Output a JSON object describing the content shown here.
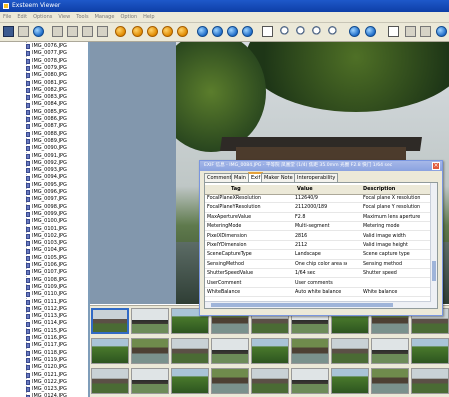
{
  "window": {
    "title": "Exsteem Viewer"
  },
  "menu": [
    "File",
    "Edit",
    "Options",
    "View",
    "Tools",
    "Manage",
    "Option",
    "Help"
  ],
  "toolbar_icons": [
    "save-icon",
    "open-icon",
    "refresh-icon",
    "cut-icon",
    "copy-icon",
    "paste-icon",
    "delete-icon",
    "circle-icon",
    "prev-icon",
    "next-icon",
    "first-icon",
    "last-icon",
    "back-icon",
    "forward-icon",
    "up-icon",
    "down-icon",
    "blank-icon",
    "zoom-in-icon",
    "zoom-out-icon",
    "zoom-fit-icon",
    "zoom-actual-icon",
    "rotate-left-icon",
    "rotate-right-icon",
    "doc-icon",
    "info-icon",
    "slideshow-icon",
    "exit-icon"
  ],
  "files": [
    "IMG_0076.JPG",
    "IMG_0077.JPG",
    "IMG_0078.JPG",
    "IMG_0079.JPG",
    "IMG_0080.JPG",
    "IMG_0081.JPG",
    "IMG_0082.JPG",
    "IMG_0083.JPG",
    "IMG_0084.JPG",
    "IMG_0085.JPG",
    "IMG_0086.JPG",
    "IMG_0087.JPG",
    "IMG_0088.JPG",
    "IMG_0089.JPG",
    "IMG_0090.JPG",
    "IMG_0091.JPG",
    "IMG_0092.JPG",
    "IMG_0093.JPG",
    "IMG_0094.JPG",
    "IMG_0095.JPG",
    "IMG_0096.JPG",
    "IMG_0097.JPG",
    "IMG_0098.JPG",
    "IMG_0099.JPG",
    "IMG_0100.JPG",
    "IMG_0101.JPG",
    "IMG_0102.JPG",
    "IMG_0103.JPG",
    "IMG_0104.JPG",
    "IMG_0105.JPG",
    "IMG_0106.JPG",
    "IMG_0107.JPG",
    "IMG_0108.JPG",
    "IMG_0109.JPG",
    "IMG_0110.JPG",
    "IMG_0111.JPG",
    "IMG_0112.JPG",
    "IMG_0113.JPG",
    "IMG_0114.JPG",
    "IMG_0115.JPG",
    "IMG_0116.JPG",
    "IMG_0117.JPG",
    "IMG_0118.JPG",
    "IMG_0119.JPG",
    "IMG_0120.JPG",
    "IMG_0121.JPG",
    "IMG_0122.JPG",
    "IMG_0123.JPG",
    "IMG_0124.JPG",
    "IMG_0125.JPG"
  ],
  "dialog": {
    "title": "EXIF 信息 - IMG_0084.JPG - 平等院 凤凰堂 (1/4) 焦距 35.0mm 光圈 F2.8 快门 1/64 sec",
    "close_label": "×",
    "tabs": [
      "Comments",
      "Main",
      "Exif",
      "Maker Note",
      "Interoperability"
    ],
    "active_tab": "Exif",
    "columns": [
      "Tag",
      "Value",
      "Description"
    ],
    "rows": [
      [
        "FocalPlaneXResolution",
        "112640/9",
        "Focal plane X resolution"
      ],
      [
        "FocalPlaneYResolution",
        "2112000/189",
        "Focal plane Y resolution"
      ],
      [
        "MaxApertureValue",
        "F2.8",
        "Maximum lens aperture"
      ],
      [
        "MeteringMode",
        "Multi-segment",
        "Metering mode"
      ],
      [
        "PixelXDimension",
        "2816",
        "Valid image width"
      ],
      [
        "PixelYDimension",
        "2112",
        "Valid image height"
      ],
      [
        "SceneCaptureType",
        "Landscape",
        "Scene capture type"
      ],
      [
        "SensingMethod",
        "One chip color area sensor",
        "Sensing method"
      ],
      [
        "ShutterSpeedValue",
        "1/64 sec",
        "Shutter speed"
      ],
      [
        "UserComment",
        "User comments",
        ""
      ],
      [
        "WhiteBalance",
        "Auto white balance",
        "White balance"
      ]
    ]
  }
}
